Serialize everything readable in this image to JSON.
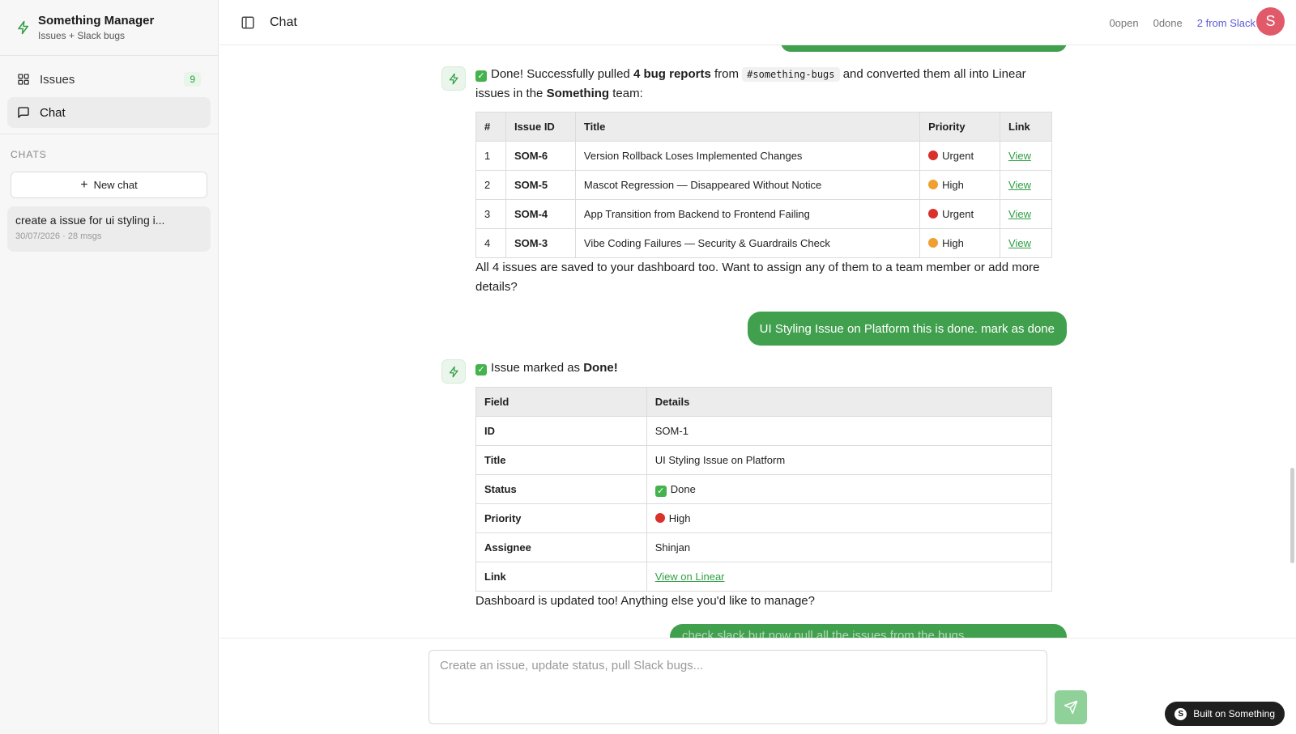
{
  "app": {
    "title": "Something Manager",
    "subtitle": "Issues + Slack bugs"
  },
  "nav": {
    "issues_label": "Issues",
    "issues_count": "9",
    "chat_label": "Chat"
  },
  "sidebar": {
    "chats_heading": "CHATS",
    "new_chat_label": "New chat",
    "chat_entries": [
      {
        "title": "create a issue for ui styling i...",
        "meta": "30/07/2026 · 28 msgs"
      }
    ]
  },
  "header": {
    "title": "Chat",
    "open_count": "0",
    "open_label": "open",
    "done_count": "0",
    "done_label": "done",
    "slack_text": "2 from Slack",
    "avatar_initial": "S"
  },
  "messages": {
    "msg1": {
      "check": "✓",
      "pre": "Done! Successfully pulled",
      "bold1": "4 bug reports",
      "mid": "from",
      "channel": "#something-bugs",
      "post": "and converted them all into Linear issues in the",
      "team": "Something",
      "end": "team:",
      "table": {
        "headers": [
          "#",
          "Issue ID",
          "Title",
          "Priority",
          "Link"
        ],
        "rows": [
          {
            "n": "1",
            "id": "SOM-6",
            "title": "Version Rollback Loses Implemented Changes",
            "priority": "Urgent",
            "priority_color": "red",
            "link": "View"
          },
          {
            "n": "2",
            "id": "SOM-5",
            "title": "Mascot Regression — Disappeared Without Notice",
            "priority": "High",
            "priority_color": "orange",
            "link": "View"
          },
          {
            "n": "3",
            "id": "SOM-4",
            "title": "App Transition from Backend to Frontend Failing",
            "priority": "Urgent",
            "priority_color": "red",
            "link": "View"
          },
          {
            "n": "4",
            "id": "SOM-3",
            "title": "Vibe Coding Failures — Security & Guardrails Check",
            "priority": "High",
            "priority_color": "orange",
            "link": "View"
          }
        ]
      },
      "footer": "All 4 issues are saved to your dashboard too. Want to assign any of them to a team member or add more details?"
    },
    "user1": "UI Styling Issue on Platform this is done. mark as done",
    "msg2": {
      "check": "✓",
      "pre": "Issue marked as",
      "bold": "Done!",
      "table": {
        "headers": [
          "Field",
          "Details"
        ],
        "rows": [
          {
            "field": "ID",
            "value": "SOM-1"
          },
          {
            "field": "Title",
            "value": "UI Styling Issue on Platform"
          },
          {
            "field": "Status",
            "value": "Done"
          },
          {
            "field": "Priority",
            "value": "High"
          },
          {
            "field": "Assignee",
            "value": "Shinjan"
          },
          {
            "field": "Link",
            "value": "View on Linear"
          }
        ]
      },
      "footer": "Dashboard is updated too! Anything else you'd like to manage?"
    },
    "user2_partial": "check slack but now pull all the issues from the bugs"
  },
  "composer": {
    "placeholder": "Create an issue, update status, pull Slack bugs...",
    "built_label": "Built on Something"
  },
  "colors": {
    "accent": "#40a04d",
    "urgent": "#d9312b",
    "high": "#f0a030"
  }
}
